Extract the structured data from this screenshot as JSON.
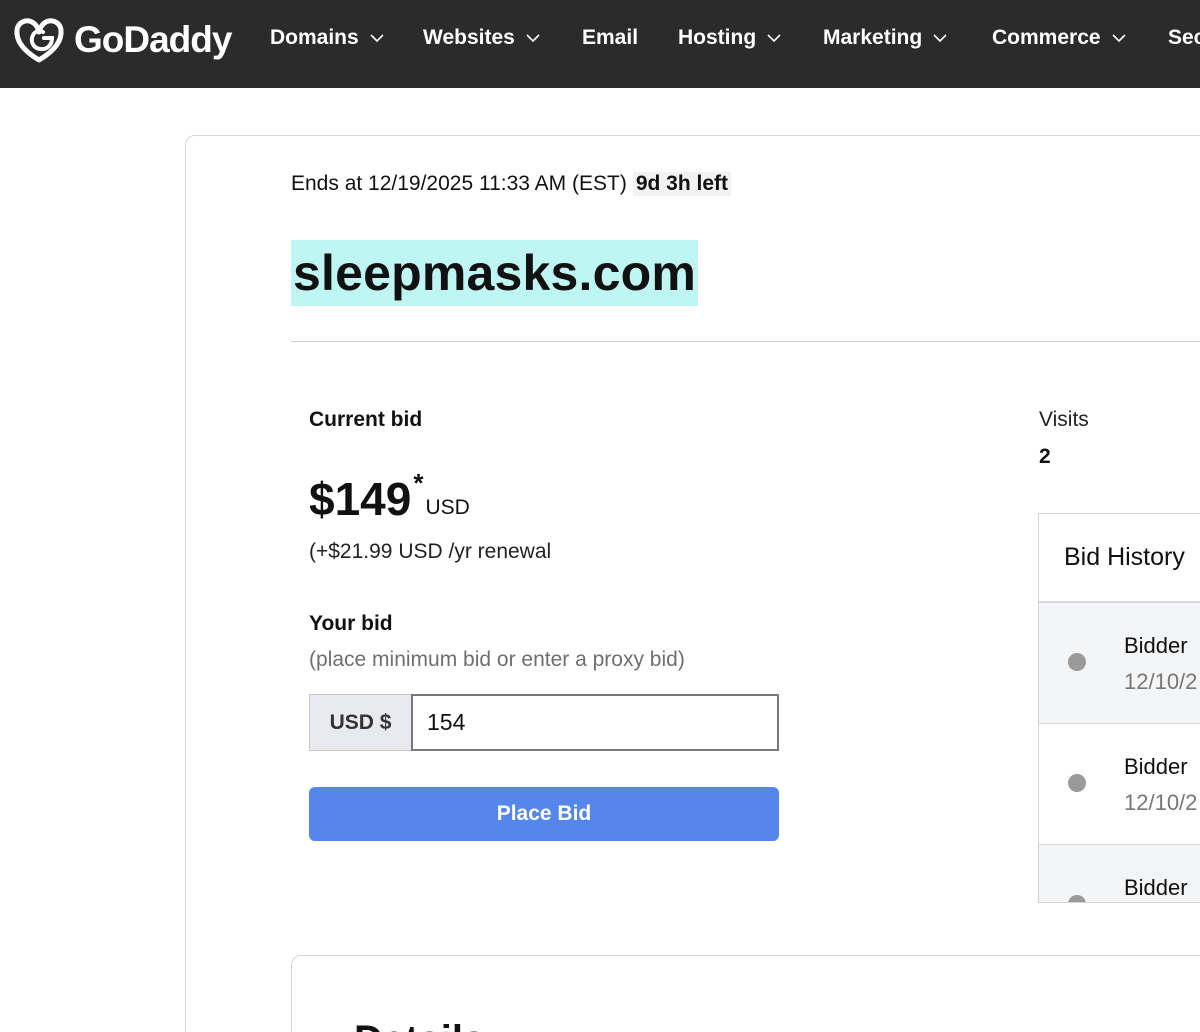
{
  "brand": {
    "name": "GoDaddy"
  },
  "nav": {
    "items": [
      {
        "label": "Domains",
        "has_menu": true
      },
      {
        "label": "Websites",
        "has_menu": true
      },
      {
        "label": "Email",
        "has_menu": false
      },
      {
        "label": "Hosting",
        "has_menu": true
      },
      {
        "label": "Marketing",
        "has_menu": true
      },
      {
        "label": "Commerce",
        "has_menu": true
      },
      {
        "label": "Sec",
        "has_menu": false
      }
    ]
  },
  "auction": {
    "ends_label": "Ends at 12/19/2025 11:33 AM (EST)",
    "time_left": "9d 3h left",
    "domain": "sleepmasks.com",
    "current_bid_label": "Current bid",
    "current_bid_amount": "$149",
    "current_bid_star": "*",
    "current_bid_currency": "USD",
    "renewal": "(+$21.99 USD /yr renewal",
    "your_bid_label": "Your bid",
    "your_bid_hint": "(place minimum bid or enter a proxy bid)",
    "bid_prefix": "USD $",
    "bid_value": "154",
    "place_bid_label": "Place Bid",
    "visits_label": "Visits",
    "visits_value": "2"
  },
  "bid_history": {
    "title": "Bid History",
    "rows": [
      {
        "name": "Bidder",
        "date": "12/10/2"
      },
      {
        "name": "Bidder",
        "date": "12/10/2"
      },
      {
        "name": "Bidder",
        "date": ""
      }
    ]
  },
  "details": {
    "title": "Details"
  },
  "colors": {
    "nav_bg": "#2b2b2b",
    "domain_highlight": "#bff6f3",
    "primary_button": "#5586ea"
  }
}
